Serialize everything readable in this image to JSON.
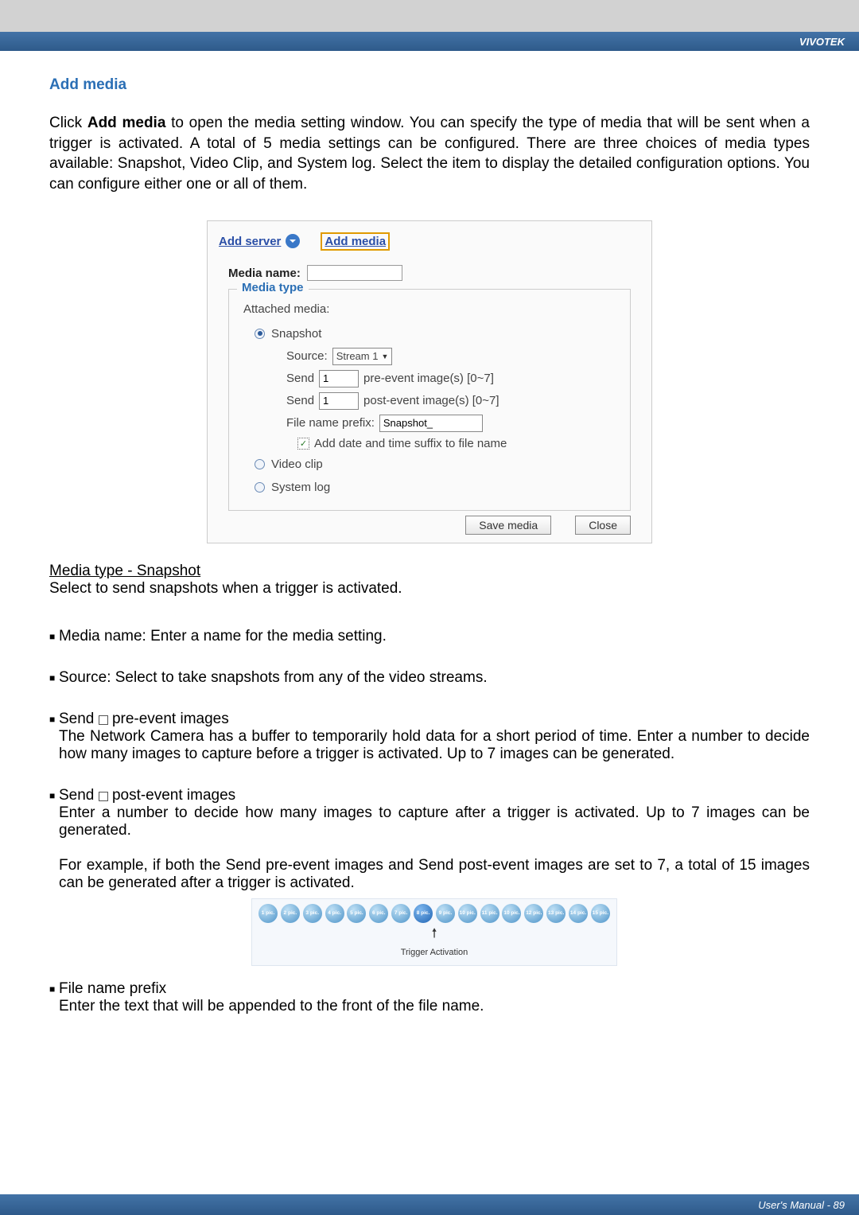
{
  "brand": "VIVOTEK",
  "footer": "User's Manual - 89",
  "section_title": "Add media",
  "intro": "Click Add media to open the media setting window. You can specify the type of media that will be sent when a trigger is activated. A total of 5 media settings can be configured. There are three choices of media types available: Snapshot, Video Clip, and System log. Select the item to display the detailed configuration options. You can configure either one or all of them.",
  "intro_bold": "Add media",
  "screenshot": {
    "add_server": "Add server",
    "add_media": "Add media",
    "media_name_label": "Media name:",
    "media_name_value": "",
    "fieldset_legend": "Media type",
    "attached_label": "Attached media:",
    "snapshot_label": "Snapshot",
    "source_label": "Source:",
    "source_value": "Stream 1",
    "send1_label": "Send",
    "send1_value": "1",
    "pre_label": "pre-event image(s) [0~7]",
    "send2_label": "Send",
    "send2_value": "1",
    "post_label": "post-event image(s) [0~7]",
    "prefix_label": "File name prefix:",
    "prefix_value": "Snapshot_",
    "suffix_label": "Add date and time suffix to file name",
    "videoclip_label": "Video clip",
    "systemlog_label": "System log",
    "save_btn": "Save media",
    "close_btn": "Close"
  },
  "subheading": "Media type - Snapshot",
  "subheading_text": "Select to send snapshots when a trigger is activated.",
  "items": [
    {
      "t": "Media name: Enter a name for the media setting."
    },
    {
      "t": "Source: Select to take snapshots from any of the video streams."
    },
    {
      "lead": "Send",
      "after_box": "pre-event images",
      "desc": "The Network Camera has a buffer to temporarily hold data for a short period of time. Enter a number to decide how many images to capture before a trigger is activated. Up to 7 images can be generated."
    },
    {
      "lead": "Send",
      "after_box": "post-event images",
      "desc": "Enter a number to decide how many images to capture after a trigger is activated. Up to 7 images can be generated.",
      "extra": "For example, if both the Send pre-event images and Send post-event images are set to 7, a total of 15 images can be generated after a trigger is activated."
    },
    {
      "lead2": "File name prefix",
      "desc": "Enter the text that will be appended to the front of the file name."
    }
  ],
  "diagram": {
    "labels": [
      "1 pic.",
      "2 pic.",
      "3 pic.",
      "4 pic.",
      "5 pic.",
      "6 pic.",
      "7 pic.",
      "8 pic.",
      "9 pic.",
      "10 pic.",
      "11 pic.",
      "10 pic.",
      "12 pic.",
      "13 pic.",
      "14 pic.",
      "15 pic."
    ],
    "active_index": 7,
    "caption": "Trigger Activation"
  }
}
